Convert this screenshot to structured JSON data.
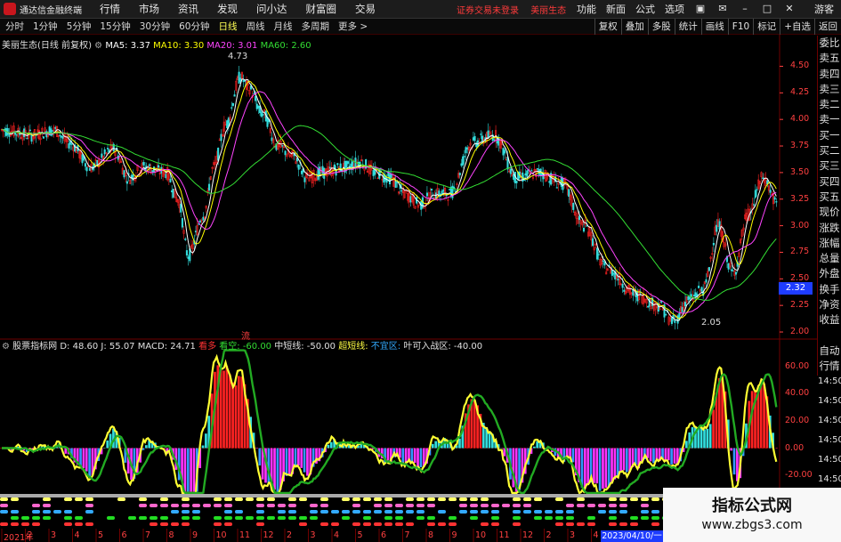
{
  "titlebar": {
    "app_title": "通达信金融终端",
    "menu": [
      "行情",
      "市场",
      "资讯",
      "发现",
      "问小达",
      "财富圈",
      "交易"
    ],
    "status": [
      "证券交易未登录",
      "美丽生态"
    ],
    "right_menu": [
      "功能",
      "新面",
      "公式",
      "选项"
    ],
    "guest": "游客"
  },
  "periodbar": {
    "periods": [
      "分时",
      "1分钟",
      "5分钟",
      "15分钟",
      "30分钟",
      "60分钟",
      "日线",
      "周线",
      "月线",
      "多周期",
      "更多 >"
    ],
    "selected": "日线",
    "tools": [
      "复权",
      "叠加",
      "多股",
      "统计",
      "画线",
      "F10",
      "标记",
      "+自选",
      "返回"
    ]
  },
  "price_legend": {
    "name": "美丽生态(日线 前复权)",
    "ma5": "MA5: 3.37",
    "ma10": "MA10: 3.30",
    "ma20": "MA20: 3.01",
    "ma60": "MA60: 2.60"
  },
  "annotations": {
    "high": "4.73",
    "low": "2.05",
    "flag": "流"
  },
  "price_axis": [
    "4.50",
    "4.25",
    "4.00",
    "3.75",
    "3.50",
    "3.25",
    "3.00",
    "2.75",
    "2.50",
    "2.25",
    "2.00"
  ],
  "last_price": "2.32",
  "indicator_legend": {
    "name": "股票指标网",
    "d": "D: 48.60",
    "j": "J: 55.07",
    "macd": "MACD: 24.71",
    "kd": "看多",
    "kk": "看空: -60.00",
    "zt": "中短线: -50.00",
    "cd": "超短线:",
    "bd": "不宜区:",
    "yk": "叶可入战区: -40.00"
  },
  "ind_axis": [
    "60.00",
    "40.00",
    "20.00",
    "0.00",
    "-20.00"
  ],
  "side_panel": [
    "委比",
    "卖五",
    "卖四",
    "卖三",
    "卖二",
    "卖一",
    "买一",
    "买二",
    "买三",
    "买四",
    "买五",
    "现价",
    "涨跌",
    "涨幅",
    "总量",
    "外盘",
    "换手",
    "净资",
    "收益"
  ],
  "side_panel2": [
    "自动",
    "行情"
  ],
  "time_axis": [
    "14:50",
    "14:50",
    "14:50",
    "14:50",
    "14:50",
    "14:50",
    "14:50",
    "14:50"
  ],
  "date_axis": [
    "2021年",
    "2",
    "3",
    "4",
    "5",
    "6",
    "7",
    "8",
    "9",
    "10",
    "11",
    "12",
    "2",
    "3",
    "4",
    "5",
    "6",
    "7",
    "8",
    "9",
    "10",
    "11",
    "12",
    "2",
    "3",
    "4"
  ],
  "date_current": "2023/04/10/一",
  "watermark": {
    "line1": "指标公式网",
    "line2": "www.zbgs3.com"
  },
  "colors": {
    "ma5": "#ffffff",
    "ma10": "#ffff00",
    "ma20": "#ff44ff",
    "ma60": "#33dd33",
    "up": "#ff2222",
    "down": "#33dddd"
  }
}
